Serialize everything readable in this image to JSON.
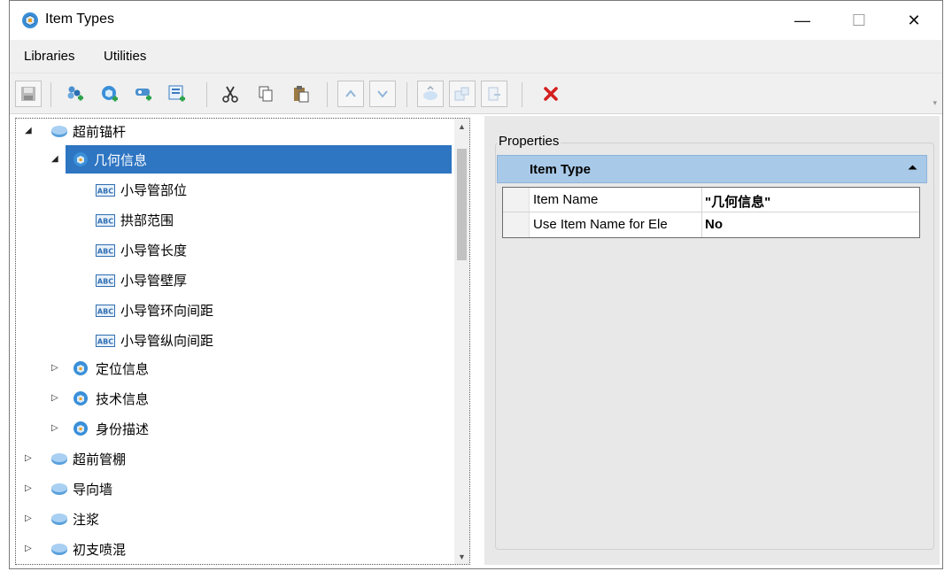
{
  "window": {
    "title": "Item Types"
  },
  "window_controls": {
    "minimize": "—",
    "maximize": "☐",
    "close": "✕"
  },
  "menu": {
    "libraries": "Libraries",
    "utilities": "Utilities"
  },
  "toolbar": {
    "buttons": [
      "save-icon",
      "new-library-icon",
      "new-item-type-icon",
      "new-property-icon",
      "new-expression-property-icon",
      "cut-icon",
      "copy-icon",
      "paste-icon",
      "move-up-icon",
      "move-down-icon",
      "attach-icon",
      "import-icon",
      "export-icon",
      "delete-icon"
    ],
    "delete_color": "#d41f1f"
  },
  "tree": {
    "nodes": [
      {
        "label": "超前锚杆",
        "expander": "◢",
        "icon": "library-icon"
      },
      {
        "label": "几何信息",
        "expander": "◢",
        "icon": "item-type-icon"
      },
      {
        "label": "小导管部位",
        "icon": "text-property-icon"
      },
      {
        "label": "拱部范围",
        "icon": "text-property-icon"
      },
      {
        "label": "小导管长度",
        "icon": "text-property-icon"
      },
      {
        "label": "小导管壁厚",
        "icon": "text-property-icon"
      },
      {
        "label": "小导管环向间距",
        "icon": "text-property-icon"
      },
      {
        "label": "小导管纵向间距",
        "icon": "text-property-icon"
      },
      {
        "label": "定位信息",
        "expander": "▷",
        "icon": "item-type-icon"
      },
      {
        "label": "技术信息",
        "expander": "▷",
        "icon": "item-type-icon"
      },
      {
        "label": "身份描述",
        "expander": "▷",
        "icon": "item-type-icon"
      },
      {
        "label": "超前管棚",
        "expander": "▷",
        "icon": "library-icon"
      },
      {
        "label": "导向墙",
        "expander": "▷",
        "icon": "library-icon"
      },
      {
        "label": "注浆",
        "expander": "▷",
        "icon": "library-icon"
      },
      {
        "label": "初支喷混",
        "expander": "▷",
        "icon": "library-icon"
      }
    ],
    "selected_color": "#2e75c2",
    "scroll_up": "▲",
    "scroll_down": "▼"
  },
  "properties": {
    "legend": "Properties",
    "section_title": "Item Type",
    "collapse_glyph": "⏶",
    "rows": [
      {
        "name": "Item Name",
        "value": "\"几何信息\""
      },
      {
        "name": "Use Item Name for Ele",
        "value": "No"
      }
    ]
  }
}
